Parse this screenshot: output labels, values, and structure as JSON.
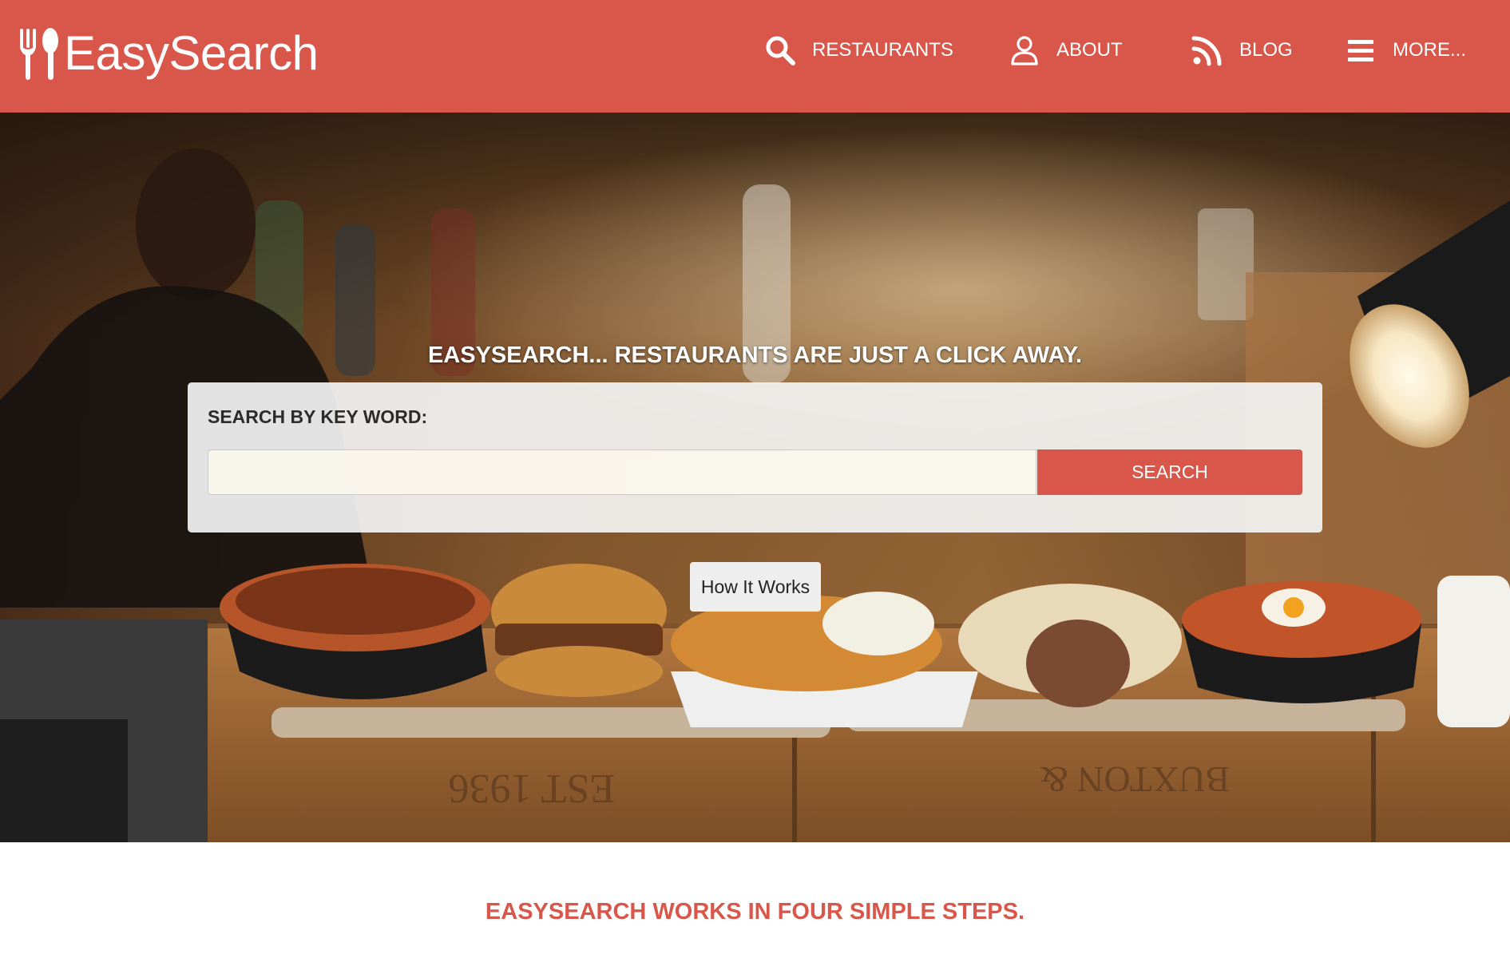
{
  "colors": {
    "brand": "#d9574a",
    "white": "#ffffff",
    "panel": "#f4f4f4"
  },
  "brand": {
    "logo_icon": "fork-spoon-icon",
    "name": "EasySearch"
  },
  "nav": {
    "items": [
      {
        "icon": "search-icon",
        "label": "RESTAURANTS"
      },
      {
        "icon": "user-icon",
        "label": "ABOUT"
      },
      {
        "icon": "rss-icon",
        "label": "BLOG"
      },
      {
        "icon": "hamburger-menu-icon",
        "label": "MORE..."
      }
    ]
  },
  "hero": {
    "tagline": "EASYSEARCH... RESTAURANTS ARE JUST A CLICK AWAY.",
    "search_label": "SEARCH BY KEY WORD:",
    "search_value": "",
    "search_placeholder": "",
    "search_button": "SEARCH",
    "how_it_works": "How It Works"
  },
  "steps": {
    "title": "EASYSEARCH WORKS IN FOUR SIMPLE STEPS."
  }
}
